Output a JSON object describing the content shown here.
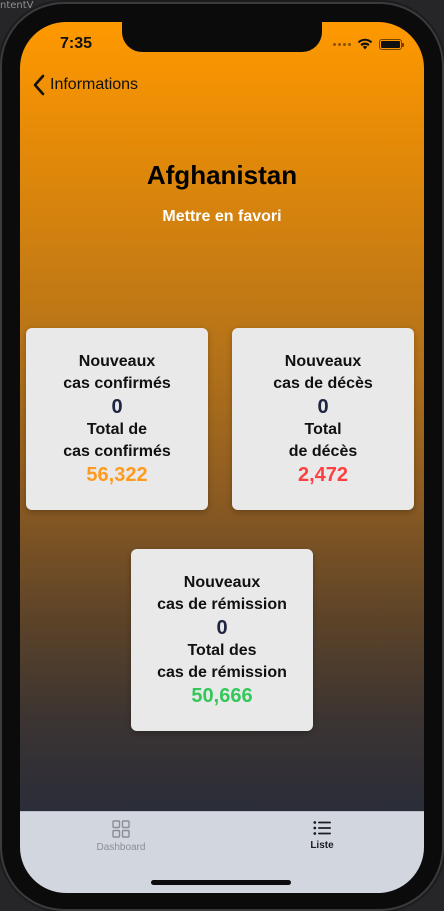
{
  "editor": {
    "label": "ntentV"
  },
  "status_bar": {
    "time": "7:35"
  },
  "nav": {
    "back_label": "Informations"
  },
  "header": {
    "country": "Afghanistan",
    "favorite_label": "Mettre en favori"
  },
  "cards": {
    "confirmed": {
      "new_line1": "Nouveaux",
      "new_line2": "cas confirmés",
      "new_value": "0",
      "total_line1": "Total de",
      "total_line2": "cas confirmés",
      "total_value": "56,322",
      "total_color": "#ff9a1e"
    },
    "deaths": {
      "new_line1": "Nouveaux",
      "new_line2": "cas de décès",
      "new_value": "0",
      "total_line1": "Total",
      "total_line2": "de décès",
      "total_value": "2,472",
      "total_color": "#ff4040"
    },
    "recovered": {
      "new_line1": "Nouveaux",
      "new_line2": "cas de rémission",
      "new_value": "0",
      "total_line1": "Total des",
      "total_line2": "cas de rémission",
      "total_value": "50,666",
      "total_color": "#34c759"
    }
  },
  "tabbar": {
    "tabs": [
      {
        "label": "Dashboard",
        "icon": "grid-icon",
        "selected": false
      },
      {
        "label": "Liste",
        "icon": "list-icon",
        "selected": true
      }
    ]
  },
  "colors": {
    "gradient_top": "#ff9900",
    "gradient_bottom": "#2b2d38",
    "card_bg": "#e9e9ea",
    "tabbar_bg": "#d2d6de"
  }
}
